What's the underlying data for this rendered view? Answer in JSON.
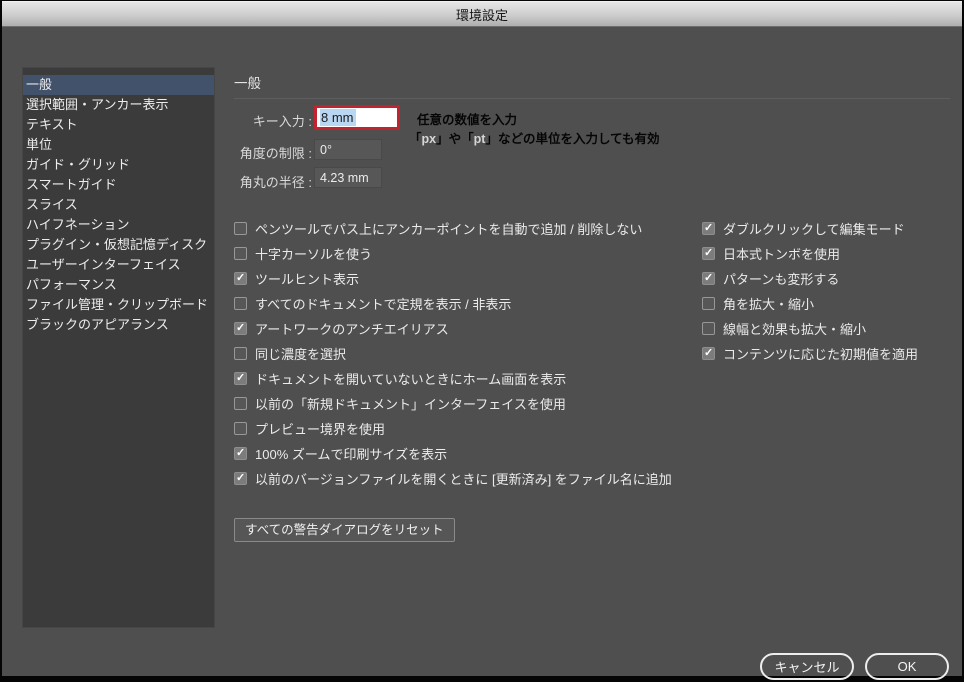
{
  "window": {
    "title": "環境設定"
  },
  "sidebar": {
    "items": [
      {
        "label": "一般",
        "selected": true
      },
      {
        "label": "選択範囲・アンカー表示",
        "selected": false
      },
      {
        "label": "テキスト",
        "selected": false
      },
      {
        "label": "単位",
        "selected": false
      },
      {
        "label": "ガイド・グリッド",
        "selected": false
      },
      {
        "label": "スマートガイド",
        "selected": false
      },
      {
        "label": "スライス",
        "selected": false
      },
      {
        "label": "ハイフネーション",
        "selected": false
      },
      {
        "label": "プラグイン・仮想記憶ディスク",
        "selected": false
      },
      {
        "label": "ユーザーインターフェイス",
        "selected": false
      },
      {
        "label": "パフォーマンス",
        "selected": false
      },
      {
        "label": "ファイル管理・クリップボード",
        "selected": false
      },
      {
        "label": "ブラックのアピアランス",
        "selected": false
      }
    ]
  },
  "main": {
    "section_title": "一般",
    "fields": {
      "key_input": {
        "label": "キー入力 :",
        "value": "8 mm"
      },
      "angle_limit": {
        "label": "角度の制限 :",
        "value": "0°"
      },
      "corner_radius": {
        "label": "角丸の半径 :",
        "value": "4.23 mm"
      }
    },
    "annotation": {
      "line1": "任意の数値を入力",
      "line2_segments": [
        {
          "t": "「"
        },
        {
          "t": "px",
          "light": true
        },
        {
          "t": "」や「"
        },
        {
          "t": "pt",
          "light": true
        },
        {
          "t": "」などの単位を入力しても有効"
        }
      ]
    },
    "checkboxes_left": [
      {
        "label": "ペンツールでパス上にアンカーポイントを自動で追加 / 削除しない",
        "checked": false
      },
      {
        "label": "十字カーソルを使う",
        "checked": false
      },
      {
        "label": "ツールヒント表示",
        "checked": true
      },
      {
        "label": "すべてのドキュメントで定規を表示 / 非表示",
        "checked": false
      },
      {
        "label": "アートワークのアンチエイリアス",
        "checked": true
      },
      {
        "label": "同じ濃度を選択",
        "checked": false
      },
      {
        "label": "ドキュメントを開いていないときにホーム画面を表示",
        "checked": true
      },
      {
        "label": "以前の「新規ドキュメント」インターフェイスを使用",
        "checked": false
      },
      {
        "label": "プレビュー境界を使用",
        "checked": false
      },
      {
        "label": "100% ズームで印刷サイズを表示",
        "checked": true
      },
      {
        "label": "以前のバージョンファイルを開くときに [更新済み] をファイル名に追加",
        "checked": true
      }
    ],
    "checkboxes_right": [
      {
        "label": "ダブルクリックして編集モード",
        "checked": true
      },
      {
        "label": "日本式トンボを使用",
        "checked": true
      },
      {
        "label": "パターンも変形する",
        "checked": true
      },
      {
        "label": "角を拡大・縮小",
        "checked": false
      },
      {
        "label": "線幅と効果も拡大・縮小",
        "checked": false
      },
      {
        "label": "コンテンツに応じた初期値を適用",
        "checked": true
      }
    ],
    "reset_button": "すべての警告ダイアログをリセット"
  },
  "footer": {
    "cancel": "キャンセル",
    "ok": "OK"
  },
  "colors": {
    "body_bg": "#4f4f4f",
    "sidebar_bg": "#3b3b3b",
    "selected_item_bg": "#42526b",
    "highlight_border": "#c2242f",
    "text_selection_bg": "#b9d6f2",
    "annotation_text": "#060606",
    "titlebar_gradient_top": "#e6e6e6",
    "titlebar_gradient_bottom": "#aeaeae"
  }
}
